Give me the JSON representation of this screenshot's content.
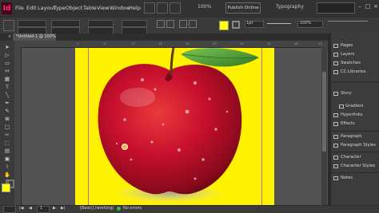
{
  "app": {
    "logo": "Id",
    "menus": [
      "File",
      "Edit",
      "Layout",
      "Type",
      "Object",
      "Table",
      "View",
      "Window",
      "Help"
    ],
    "zoom": "100%",
    "publish_label": "Publish Online",
    "workspace": "Typography",
    "window_controls": [
      "–",
      "□",
      "×"
    ]
  },
  "document": {
    "tab_title": "*Untitled-1 @ 100%",
    "tab_close": "×"
  },
  "control_bar": {
    "stroke_value": "1pt",
    "percent_value": "100%"
  },
  "rulers": {
    "horizontal_ticks": [
      "0",
      "6",
      "12",
      "18",
      "24",
      "30",
      "36",
      "42",
      "48",
      "54"
    ]
  },
  "panels": [
    {
      "label": "Pages",
      "icon": "pages-icon"
    },
    {
      "label": "Layers",
      "icon": "layers-icon"
    },
    {
      "label": "Swatches",
      "icon": "swatches-icon"
    },
    {
      "label": "CC Libraries",
      "icon": "cc-libraries-icon"
    },
    {
      "label": "Story",
      "icon": "story-icon"
    },
    {
      "label": "Gradient",
      "icon": "gradient-icon"
    },
    {
      "label": "Hyperlinks",
      "icon": "hyperlinks-icon"
    },
    {
      "label": "Effects",
      "icon": "effects-icon"
    },
    {
      "label": "Paragraph",
      "icon": "paragraph-icon"
    },
    {
      "label": "Paragraph Styles",
      "icon": "paragraph-styles-icon"
    },
    {
      "label": "Character",
      "icon": "character-icon"
    },
    {
      "label": "Character Styles",
      "icon": "character-styles-icon"
    },
    {
      "label": "Notes",
      "icon": "notes-icon"
    }
  ],
  "status_bar": {
    "page": "1",
    "preflight_profile": "[Basic] (working)",
    "preflight_status": "No errors"
  },
  "colors": {
    "page_background": "#fff200",
    "accent": "#ff3366",
    "apple_red": "#c8102e",
    "leaf_green": "#3f9a2f",
    "status_ok": "#2fbf3f"
  }
}
